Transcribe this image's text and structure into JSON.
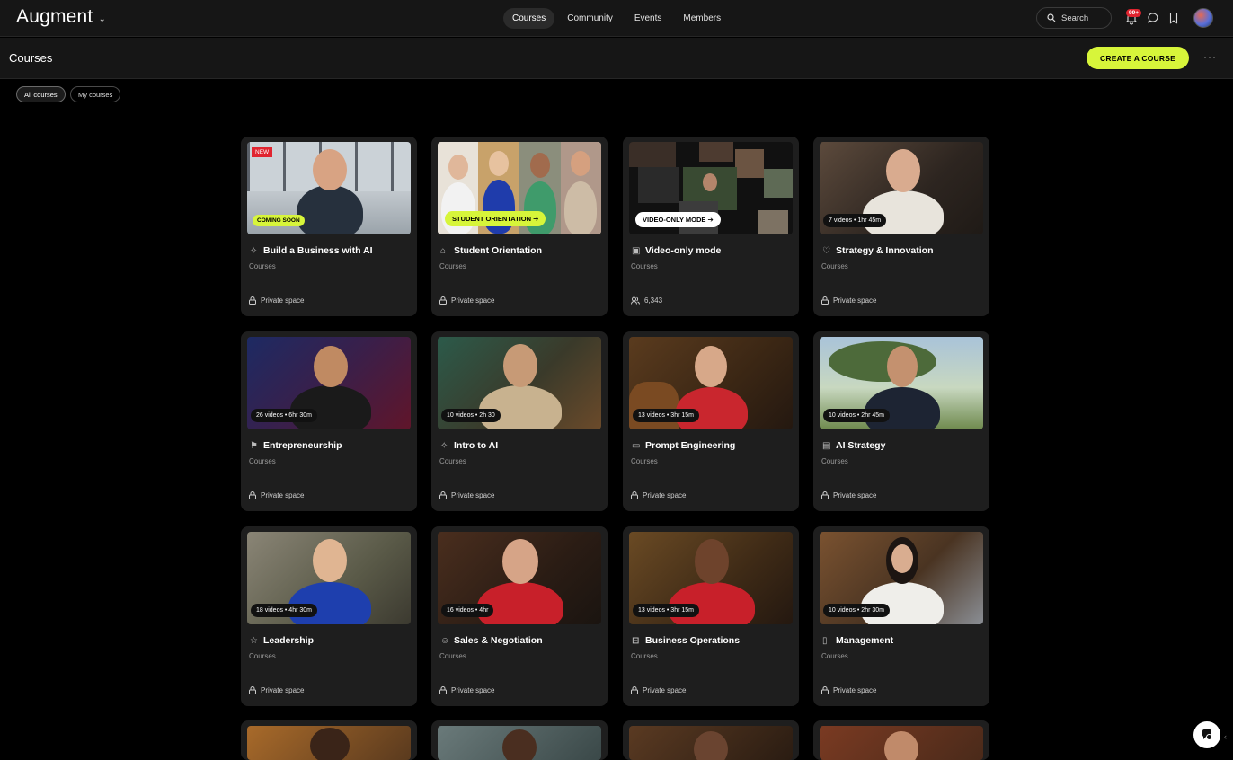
{
  "app": {
    "brand": "Augment",
    "nav": [
      "Courses",
      "Community",
      "Events",
      "Members"
    ],
    "active_nav": "Courses",
    "search_label": "Search",
    "notification_count": "99+"
  },
  "page": {
    "title": "Courses",
    "create_label": "CREATE A COURSE",
    "more_label": "···",
    "filters": [
      "All courses",
      "My courses"
    ]
  },
  "courses": [
    {
      "title": "Build a Business with AI",
      "sub": "Courses",
      "foot": "Private space",
      "meta": "",
      "icon": "sparkle-icon"
    },
    {
      "title": "Student Orientation",
      "sub": "Courses",
      "foot": "Private space",
      "meta": "",
      "icon": "graduation-cap-icon"
    },
    {
      "title": "Video-only mode",
      "sub": "Courses",
      "foot": "6,343",
      "meta": "",
      "icon": "video-icon"
    },
    {
      "title": "Strategy & Innovation",
      "sub": "Courses",
      "foot": "Private space",
      "meta": "7 videos • 1hr 45m",
      "icon": "lightbulb-icon"
    },
    {
      "title": "Entrepreneurship",
      "sub": "Courses",
      "foot": "Private space",
      "meta": "26 videos • 6hr 30m",
      "icon": "rocket-icon"
    },
    {
      "title": "Intro to AI",
      "sub": "Courses",
      "foot": "Private space",
      "meta": "10 videos • 2h 30",
      "icon": "sparkle-icon"
    },
    {
      "title": "Prompt Engineering",
      "sub": "Courses",
      "foot": "Private space",
      "meta": "13 videos • 3hr 15m",
      "icon": "terminal-icon"
    },
    {
      "title": "AI Strategy",
      "sub": "Courses",
      "foot": "Private space",
      "meta": "10 videos • 2hr 45m",
      "icon": "presentation-icon"
    },
    {
      "title": "Leadership",
      "sub": "Courses",
      "foot": "Private space",
      "meta": "18 videos • 4hr 30m",
      "icon": "star-icon"
    },
    {
      "title": "Sales & Negotiation",
      "sub": "Courses",
      "foot": "Private space",
      "meta": "16 videos • 4hr",
      "icon": "handshake-icon"
    },
    {
      "title": "Business Operations",
      "sub": "Courses",
      "foot": "Private space",
      "meta": "13 videos • 3hr 15m",
      "icon": "briefcase-icon"
    },
    {
      "title": "Management",
      "sub": "Courses",
      "foot": "Private space",
      "meta": "10 videos • 2hr 30m",
      "icon": "clipboard-icon"
    }
  ],
  "tags": {
    "new": "NEW",
    "coming_soon": "COMING SOON",
    "orientation": "STUDENT ORIENTATION ➔",
    "video_only": "VIDEO-ONLY MODE ➔"
  }
}
